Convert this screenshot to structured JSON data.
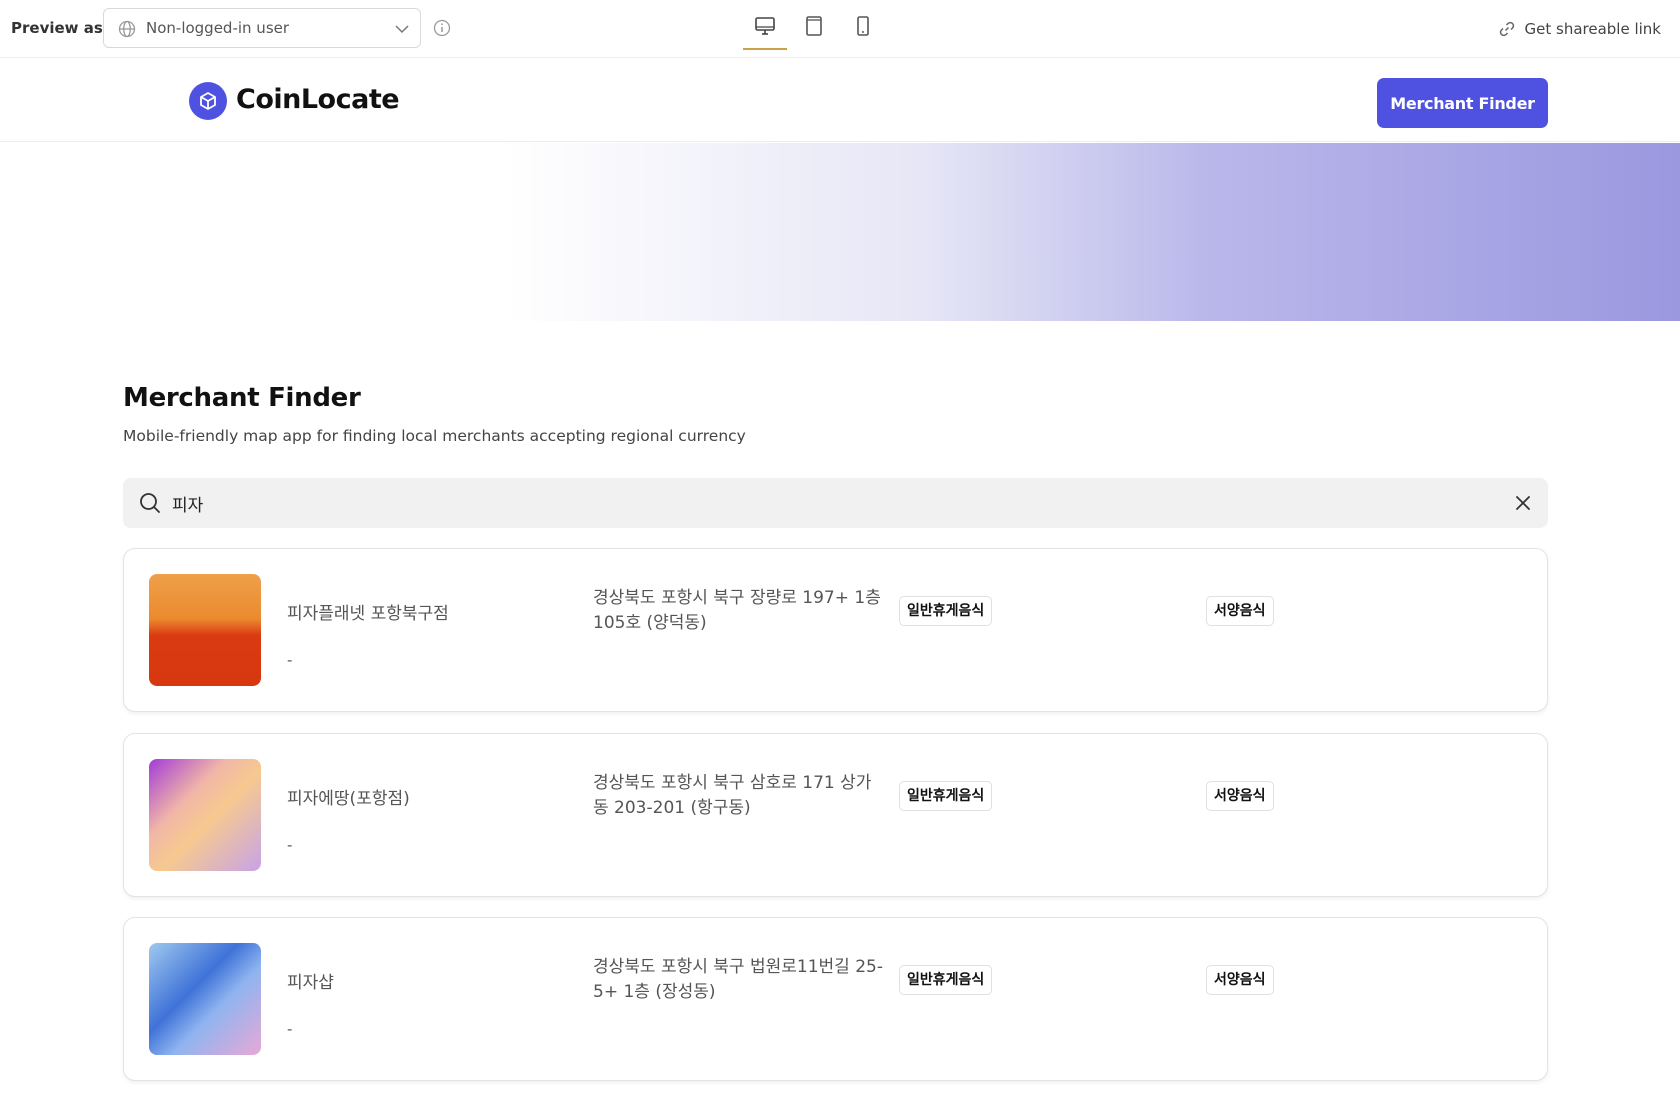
{
  "preview_bar": {
    "label": "Preview as:",
    "selected_user": "Non-logged-in user",
    "share_label": "Get shareable link",
    "active_device": "desktop"
  },
  "header": {
    "brand": "CoinLocate",
    "button_label": "Merchant Finder",
    "accent_color": "#4f52e0"
  },
  "main": {
    "title": "Merchant Finder",
    "subtitle": "Mobile-friendly map app for finding local merchants accepting regional currency",
    "search": {
      "value": "피자"
    },
    "merchants": [
      {
        "name": "피자플래넷 포항북구점",
        "phone": "-",
        "address": "경상북도 포항시 북구 장량로 197+ 1층 105호 (양덕동)",
        "category": "일반휴게음식",
        "cuisine": "서양음식"
      },
      {
        "name": "피자에땅(포항점)",
        "phone": "-",
        "address": "경상북도 포항시 북구 삼호로 171 상가동 203-201 (항구동)",
        "category": "일반휴게음식",
        "cuisine": "서양음식"
      },
      {
        "name": "피자샵",
        "phone": "-",
        "address": "경상북도 포항시 북구 법원로11번길 25-5+ 1층 (장성동)",
        "category": "일반휴게음식",
        "cuisine": "서양음식"
      }
    ]
  }
}
